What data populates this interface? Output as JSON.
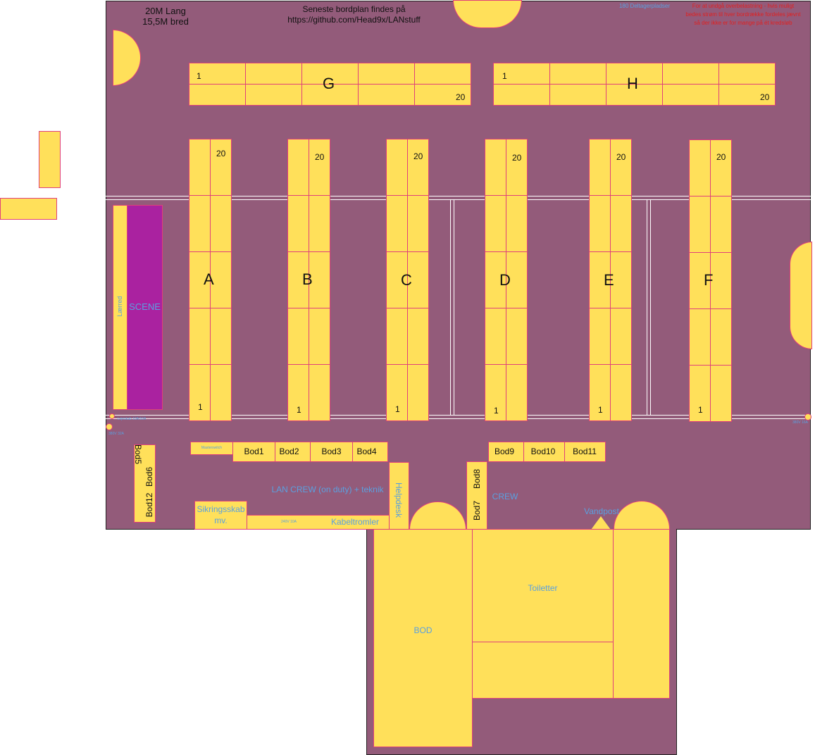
{
  "header": {
    "dim_length": "20M Lang",
    "dim_width": "15,5M bred",
    "plan_note_1": "Seneste bordplan findes på",
    "plan_note_2": "https://github.com/Head9x/LANstuff",
    "seats_note": "180 Deltagerpladser",
    "red_note_1": "For at undgå overbelastning - hvis muligt",
    "red_note_2": "bedes strøm til hver bordrække fordeles jævnt",
    "red_note_3": "så der ikke er for mange på ét kredsløb"
  },
  "rows": {
    "G": {
      "label": "G",
      "first": "1",
      "last": "20"
    },
    "H": {
      "label": "H",
      "first": "1",
      "last": "20"
    },
    "A": {
      "label": "A",
      "first": "1",
      "last": "20"
    },
    "B": {
      "label": "B",
      "first": "1",
      "last": "20"
    },
    "C": {
      "label": "C",
      "first": "1",
      "last": "20"
    },
    "D": {
      "label": "D",
      "first": "1",
      "last": "20"
    },
    "E": {
      "label": "E",
      "first": "1",
      "last": "20"
    },
    "F": {
      "label": "F",
      "first": "1",
      "last": "20"
    }
  },
  "stage": {
    "canvas": "Lærred",
    "scene": "SCENE"
  },
  "power": {
    "left_top": "Lejeskab 10A/16A",
    "left_bottom": "380V 32A",
    "right": "380V 16A",
    "cable_drum": "240V 10A"
  },
  "booths": {
    "masterswitch": "Masterswitch",
    "bod1": "Bod1",
    "bod2": "Bod2",
    "bod3": "Bod3",
    "bod4": "Bod4",
    "bod5": "Bod5",
    "bod6": "Bod6",
    "bod12": "Bod12",
    "bod7": "Bod7",
    "bod8": "Bod8",
    "bod9": "Bod9",
    "bod10": "Bod10",
    "bod11": "Bod11"
  },
  "areas": {
    "lan_crew": "LAN CREW (on duty) + teknik",
    "helpdesk": "Helpdesk",
    "crew": "CREW",
    "vandpost": "Vandpost",
    "sikringsskab_1": "Sikringsskab",
    "sikringsskab_2": "mv.",
    "kabeltromler": "Kabeltromler",
    "bod": "BOD",
    "toiletter": "Toiletter"
  }
}
